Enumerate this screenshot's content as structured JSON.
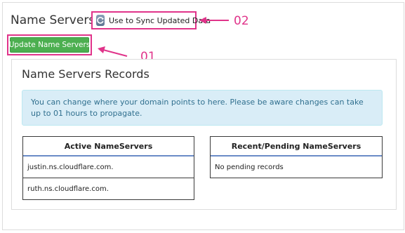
{
  "header": {
    "title": "Name Servers",
    "sync_label": "Use to Sync Updated Data",
    "update_button_label": "Update Name Servers"
  },
  "annotations": {
    "marker_02": "02",
    "marker_01": "01",
    "accent_color": "#e0348a"
  },
  "records": {
    "title": "Name Servers Records",
    "alert": "You can change where your domain points to here. Please be aware changes can take up to 01 hours to propagate."
  },
  "active": {
    "header": "Active NameServers",
    "rows": [
      "justin.ns.cloudflare.com.",
      "ruth.ns.cloudflare.com."
    ]
  },
  "pending": {
    "header": "Recent/Pending NameServers",
    "rows": [
      "No pending records"
    ]
  },
  "icons": {
    "sync": "refresh-icon"
  },
  "colors": {
    "update_button": "#4caf50",
    "alert_bg": "#d9edf7",
    "alert_text": "#31708f"
  }
}
